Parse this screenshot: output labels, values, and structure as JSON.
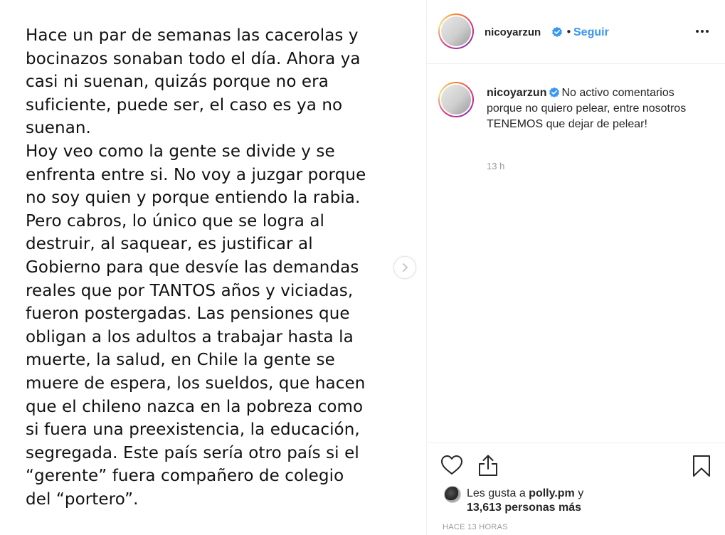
{
  "post": {
    "text": "Hace un par de semanas las cacerolas y\nbocinazos sonaban todo el día. Ahora ya\ncasi ni suenan, quizás porque no era\nsuficiente, puede ser, el caso es ya no\nsuenan.\nHoy veo como la gente se divide y se\nenfrenta entre si. No voy a juzgar porque\nno soy quien y porque entiendo la rabia.\nPero cabros, lo único que se logra al\ndestruir, al saquear, es justificar al\nGobierno para que desvíe las demandas\nreales que por TANTOS años y viciadas,\nfueron postergadas. Las pensiones que\nobligan a los adultos a trabajar hasta la\nmuerte, la salud, en Chile la gente se\nmuere de espera, los sueldos, que hacen\nque el chileno nazca en la pobreza como\nsi fuera una preexistencia, la educación,\nsegregada. Este país sería otro país si el\n“gerente” fuera compañero de colegio\ndel “portero”."
  },
  "header": {
    "username": "nicoyarzun",
    "separator": "•",
    "follow_label": "Seguir"
  },
  "caption": {
    "username": "nicoyarzun",
    "text": "No activo comentarios porque no quiero pelear, entre nosotros TENEMOS que dejar de pelear!",
    "time": "13 h"
  },
  "likes": {
    "prefix": "Les gusta a ",
    "user": "polly.pm",
    "suffix": " y",
    "others": "13,613 personas más"
  },
  "posted": "HACE 13 HORAS",
  "colors": {
    "accent": "#3897f0",
    "verified": "#3897f0",
    "muted": "#999999",
    "border": "#efefef"
  },
  "icons": [
    "chevron-right-icon",
    "verified-badge-icon",
    "more-options-icon",
    "heart-icon",
    "share-icon",
    "bookmark-icon"
  ]
}
